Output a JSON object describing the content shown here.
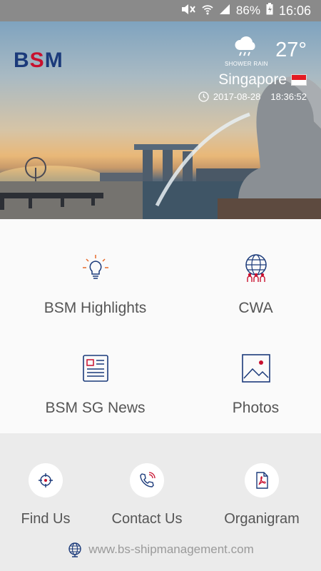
{
  "status_bar": {
    "battery": "86%",
    "time": "16:06"
  },
  "hero": {
    "logo": {
      "b": "B",
      "s": "S",
      "m": "M"
    },
    "weather": {
      "temperature": "27°",
      "condition": "SHOWER RAIN"
    },
    "city": "Singapore",
    "date": "2017-08-28",
    "time": "18:36:52"
  },
  "menu": {
    "highlights": "BSM Highlights",
    "cwa": "CWA",
    "news": "BSM SG News",
    "photos": "Photos"
  },
  "bottom": {
    "find_us": "Find Us",
    "contact_us": "Contact Us",
    "organigram": "Organigram",
    "website": "www.bs-shipmanagement.com"
  },
  "colors": {
    "accent_navy": "#1b3a7a",
    "accent_red": "#c8102e",
    "status_bar": "#8a8a8a"
  }
}
